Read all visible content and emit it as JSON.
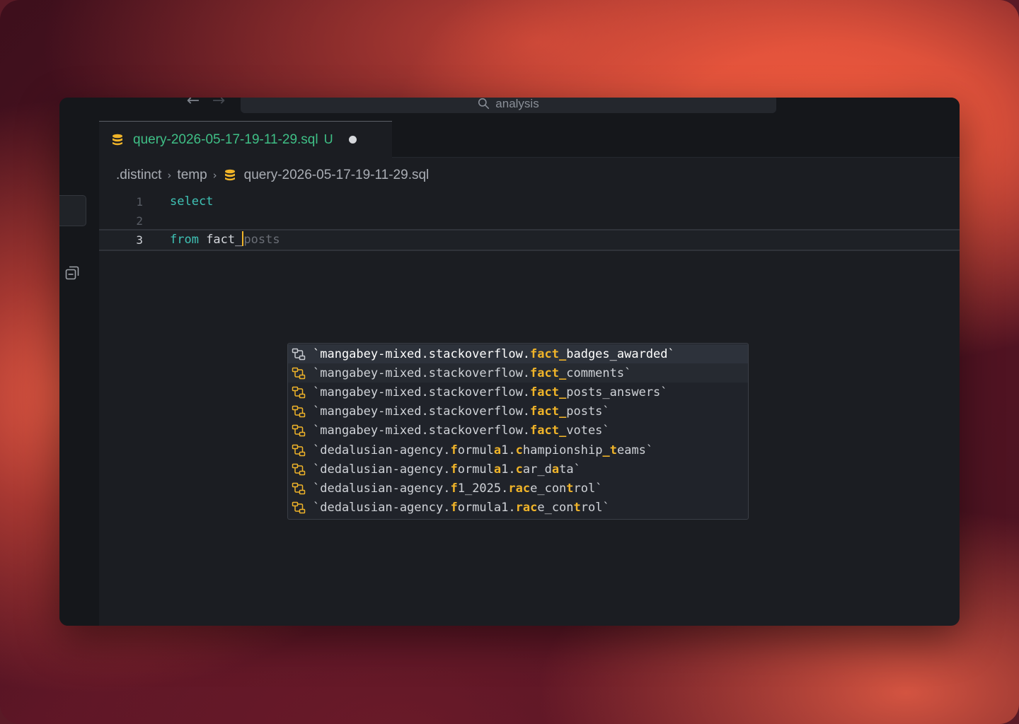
{
  "titlebar": {
    "back_icon": "arrow-left-icon",
    "forward_icon": "arrow-right-icon",
    "search_text": "analysis",
    "search_icon": "search-icon"
  },
  "tab": {
    "title": "query-2026-05-17-19-11-29.sql",
    "status": "U",
    "icon": "database-icon",
    "dirty_indicator": "unsaved-dot"
  },
  "breadcrumb": {
    "items": [
      ".distinct",
      "temp",
      "query-2026-05-17-19-11-29.sql"
    ],
    "separator": "›"
  },
  "editor": {
    "lines": [
      {
        "number": "1",
        "keyword": "select",
        "text": "",
        "ghost": ""
      },
      {
        "number": "2",
        "keyword": "",
        "text": "",
        "ghost": ""
      },
      {
        "number": "3",
        "keyword": "from",
        "text": " fact_",
        "ghost": "posts"
      }
    ],
    "active_line": "3"
  },
  "autocomplete": {
    "items": [
      {
        "parts": [
          [
            "`mangabey-mixed.stackoverflow.",
            false
          ],
          [
            "fact_",
            true
          ],
          [
            "badges_awarded`",
            false
          ]
        ]
      },
      {
        "parts": [
          [
            "`mangabey-mixed.stackoverflow.",
            false
          ],
          [
            "fact_",
            true
          ],
          [
            "comments`",
            false
          ]
        ]
      },
      {
        "parts": [
          [
            "`mangabey-mixed.stackoverflow.",
            false
          ],
          [
            "fact_",
            true
          ],
          [
            "posts_answers`",
            false
          ]
        ]
      },
      {
        "parts": [
          [
            "`mangabey-mixed.stackoverflow.",
            false
          ],
          [
            "fact_",
            true
          ],
          [
            "posts`",
            false
          ]
        ]
      },
      {
        "parts": [
          [
            "`mangabey-mixed.stackoverflow.",
            false
          ],
          [
            "fact_",
            true
          ],
          [
            "votes`",
            false
          ]
        ]
      },
      {
        "parts": [
          [
            "`dedalusian-agency.",
            false
          ],
          [
            "f",
            true
          ],
          [
            "ormul",
            false
          ],
          [
            "a",
            true
          ],
          [
            "1.",
            false
          ],
          [
            "c",
            true
          ],
          [
            "hampionship",
            false
          ],
          [
            "_t",
            true
          ],
          [
            "eams`",
            false
          ]
        ]
      },
      {
        "parts": [
          [
            "`dedalusian-agency.",
            false
          ],
          [
            "f",
            true
          ],
          [
            "ormul",
            false
          ],
          [
            "a",
            true
          ],
          [
            "1.",
            false
          ],
          [
            "c",
            true
          ],
          [
            "ar_d",
            false
          ],
          [
            "a",
            true
          ],
          [
            "ta`",
            false
          ]
        ]
      },
      {
        "parts": [
          [
            "`dedalusian-agency.",
            false
          ],
          [
            "f",
            true
          ],
          [
            "1_2025.",
            false
          ],
          [
            "r",
            true
          ],
          [
            "ac",
            true
          ],
          [
            "e_con",
            false
          ],
          [
            "t",
            true
          ],
          [
            "rol`",
            false
          ]
        ]
      },
      {
        "parts": [
          [
            "`dedalusian-agency.",
            false
          ],
          [
            "f",
            true
          ],
          [
            "ormula1.",
            false
          ],
          [
            "r",
            true
          ],
          [
            "ac",
            true
          ],
          [
            "e_con",
            false
          ],
          [
            "t",
            true
          ],
          [
            "rol`",
            false
          ]
        ]
      }
    ],
    "selected_index": 0,
    "hover_index": 1,
    "item_icon": "table-relation-icon"
  },
  "colors": {
    "accent_green": "#3fbf86",
    "keyword_teal": "#3fc2b5",
    "match_yellow": "#f0b429",
    "db_icon_yellow": "#f0b429"
  }
}
